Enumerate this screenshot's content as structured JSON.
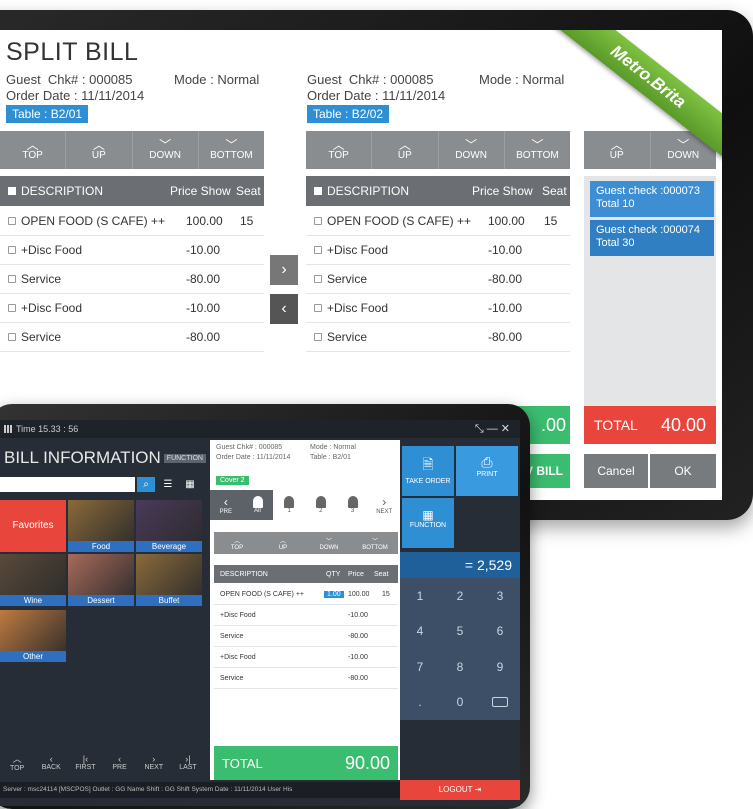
{
  "brand_ribbon": "Metro.Brita",
  "split_bill": {
    "title": "SPLIT BILL",
    "left": {
      "guest": "Guest",
      "chk": "Chk# : 000085",
      "mode": "Mode : Normal",
      "order_date": "Order Date : 11/11/2014",
      "table": "Table : B2/01"
    },
    "right": {
      "guest": "Guest",
      "chk": "Chk# : 000085",
      "mode": "Mode : Normal",
      "order_date": "Order Date : 11/11/2014",
      "table": "Table : B2/02"
    },
    "nav": {
      "top": "TOP",
      "up": "UP",
      "down": "DOWN",
      "bottom": "BOTTOM"
    },
    "columns": {
      "description": "DESCRIPTION",
      "price": "Price Show",
      "seat": "Seat"
    },
    "items": [
      {
        "desc": "OPEN FOOD (S CAFE) ++",
        "price": "100.00",
        "seat": "15"
      },
      {
        "desc": "+Disc Food",
        "price": "-10.00",
        "seat": ""
      },
      {
        "desc": "Service",
        "price": "-80.00",
        "seat": ""
      },
      {
        "desc": "+Disc Food",
        "price": "-10.00",
        "seat": ""
      },
      {
        "desc": "Service",
        "price": "-80.00",
        "seat": ""
      }
    ],
    "guest_checks": [
      {
        "label": "Guest check :000073",
        "total": "Total 10"
      },
      {
        "label": "Guest check :000074",
        "total": "Total 30"
      }
    ],
    "partial_total": ".00",
    "total_label": "TOTAL",
    "total_value": "40.00",
    "partial_button": "V BILL",
    "cancel": "Cancel",
    "ok": "OK"
  },
  "bill_info": {
    "time": "Time 15.33 : 56",
    "title": "BILL INFORMATION",
    "function_tag": "FUNCTION",
    "categories": [
      "Favorites",
      "Food",
      "Beverage",
      "Wine",
      "Dessert",
      "Buffet",
      "Other"
    ],
    "bottom_nav": [
      "TOP",
      "BACK",
      "FIRST",
      "PRE",
      "NEXT",
      "LAST"
    ],
    "status": "Server : msc24114 [MSCPOS]  Outlet : GG Name  Shift : GG Shift  System Date : 11/11/2014 User His",
    "logout": "LOGOUT",
    "header": {
      "guest": "Guest  Chk# : 000085",
      "mode": "Mode : Normal",
      "order_date": "Order Date : 11/11/2014",
      "table": "Table : B2/01",
      "cover": "Cover 2"
    },
    "seats": {
      "pre": "PRE",
      "all": "All",
      "s1": "1",
      "s2": "2",
      "s3": "3",
      "next": "NEXT"
    },
    "nav": {
      "top": "TOP",
      "up": "UP",
      "down": "DOWN",
      "bottom": "BOTTOM"
    },
    "columns": {
      "description": "DESCRIPTION",
      "qty": "QTY",
      "price": "Price",
      "seat": "Seat"
    },
    "items": [
      {
        "desc": "OPEN FOOD (S CAFE) ++",
        "qty": "1.00",
        "price": "100.00",
        "seat": "15"
      },
      {
        "desc": "+Disc Food",
        "qty": "",
        "price": "-10.00",
        "seat": ""
      },
      {
        "desc": "Service",
        "qty": "",
        "price": "-80.00",
        "seat": ""
      },
      {
        "desc": "+Disc Food",
        "qty": "",
        "price": "-10.00",
        "seat": ""
      },
      {
        "desc": "Service",
        "qty": "",
        "price": "-80.00",
        "seat": ""
      }
    ],
    "total_label": "TOTAL",
    "total_value": "90.00",
    "take_order": "TAKE ORDER",
    "print": "PRINT",
    "function": "FUNCTION",
    "display": "= 2,529",
    "keys": [
      "1",
      "2",
      "3",
      "4",
      "5",
      "6",
      "7",
      "8",
      "9",
      ".",
      "0"
    ]
  },
  "colors": {
    "blue": "#2e8fd4",
    "green": "#3bbd6f",
    "red": "#e8453c",
    "grey": "#8a8d90"
  }
}
